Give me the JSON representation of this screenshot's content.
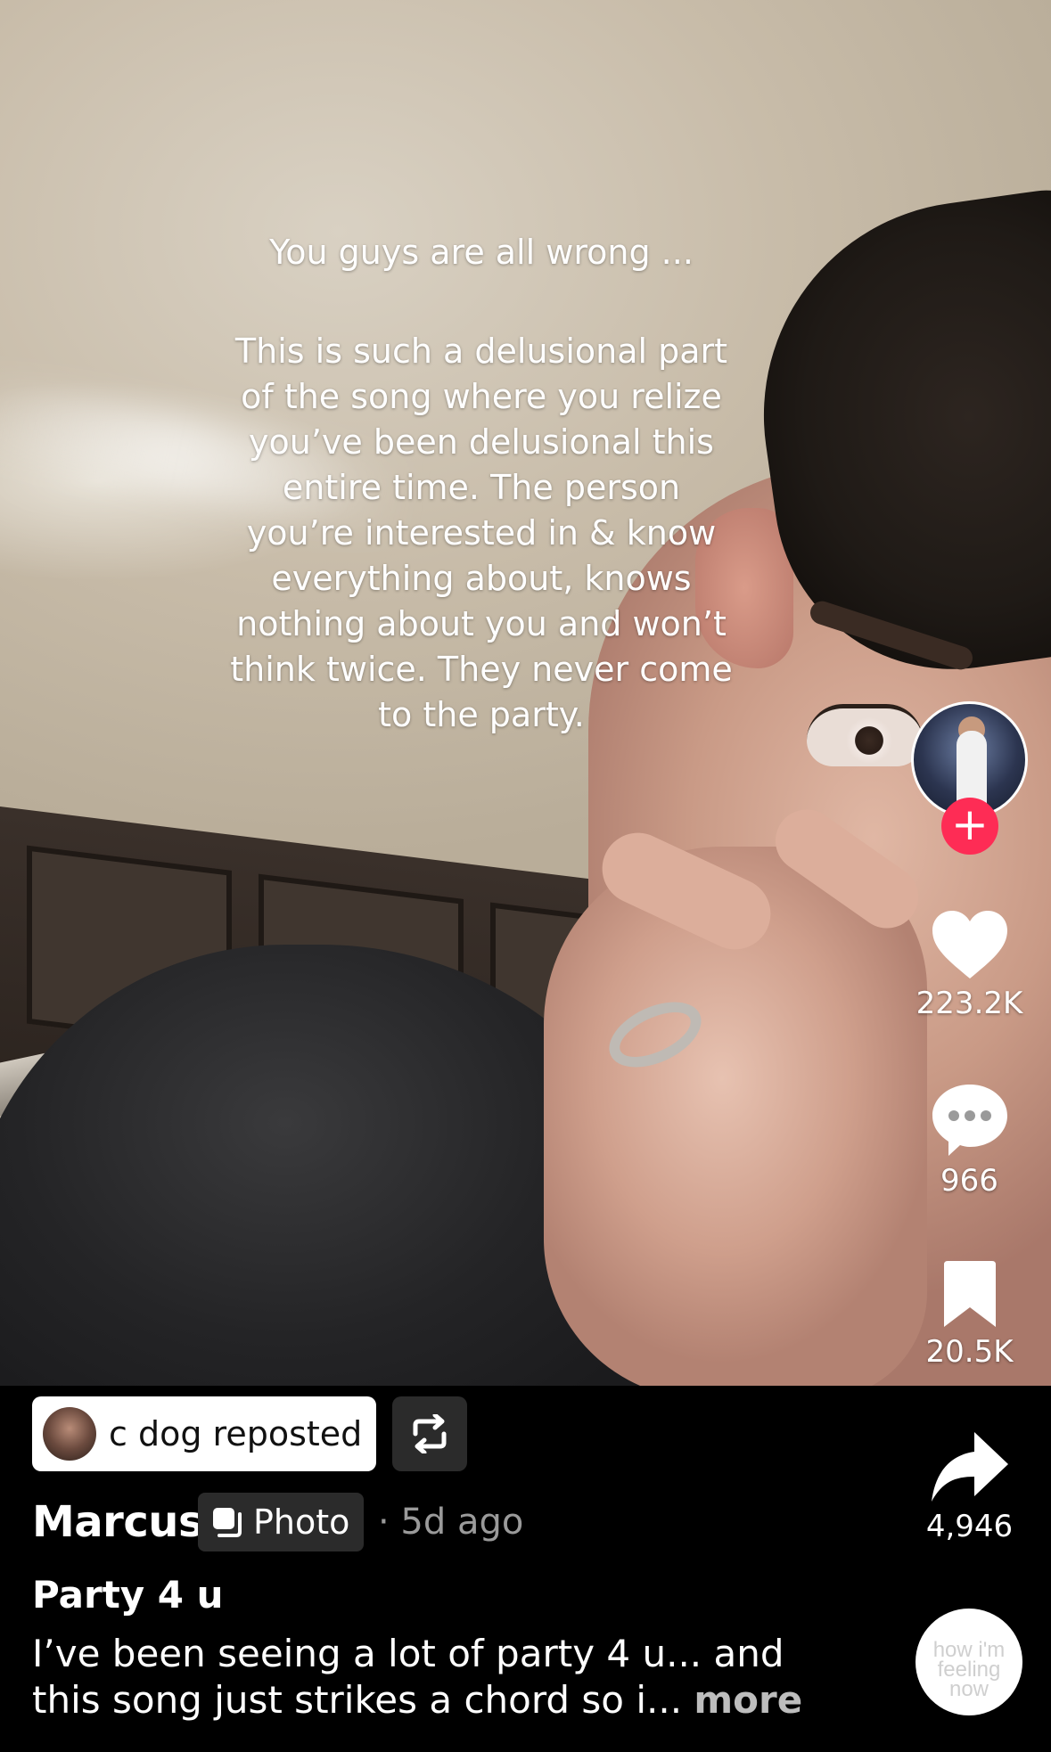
{
  "overlay": {
    "headline": "You guys are all wrong ...",
    "body_lines": [
      "This is such a delusional part",
      "of the song where you relize",
      "you’ve been delusional this",
      "entire time. The person",
      "you’re interested in & know",
      "everything about, knows",
      "nothing about you and won’t",
      "think twice. They never come",
      "to the party."
    ]
  },
  "rail": {
    "follow_icon": "plus-icon",
    "follow_symbol": "+",
    "likes": "223.2K",
    "comments": "966",
    "saves": "20.5K",
    "shares": "4,946",
    "sound_label": "how i'm feeling now"
  },
  "repost": {
    "label": "c dog reposted",
    "icon": "repost-icon"
  },
  "post": {
    "author": "Marcus",
    "type_label": "Photo",
    "time": "· 5d ago",
    "title": "Party 4 u",
    "description_line1": "I’ve been seeing a lot of party 4 u... and",
    "description_line2": "this song just strikes a chord so i...",
    "more_label": "more"
  },
  "colors": {
    "accent": "#fe2c55",
    "background": "#000000",
    "chip_dark": "#2b2b2b",
    "muted_text": "#9a9a9a"
  }
}
